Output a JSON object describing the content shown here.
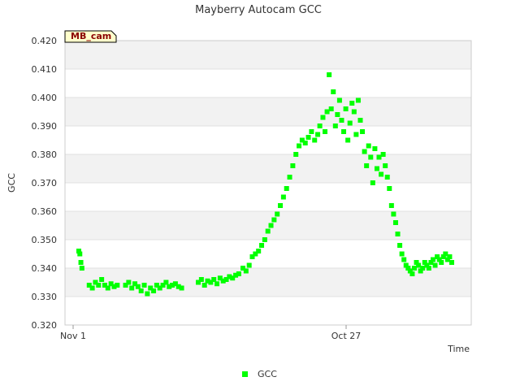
{
  "chart_data": {
    "type": "scatter",
    "title": "Mayberry Autocam GCC",
    "xlabel": "Time",
    "ylabel": "GCC",
    "ylim": [
      0.32,
      0.42
    ],
    "y_ticks": [
      "0.320",
      "0.330",
      "0.340",
      "0.350",
      "0.360",
      "0.370",
      "0.380",
      "0.390",
      "0.400",
      "0.410",
      "0.420"
    ],
    "x_ticks": [
      "Nov 1",
      "Oct 27"
    ],
    "grid": true,
    "legend_position": "bottom",
    "site_tag": "MB_cam",
    "series": [
      {
        "name": "GCC",
        "color": "#00ff00",
        "points": [
          [
            305,
            0.346
          ],
          [
            306,
            0.345
          ],
          [
            307,
            0.342
          ],
          [
            308,
            0.34
          ],
          [
            315,
            0.334
          ],
          [
            318,
            0.333
          ],
          [
            321,
            0.335
          ],
          [
            324,
            0.334
          ],
          [
            327,
            0.336
          ],
          [
            330,
            0.334
          ],
          [
            333,
            0.333
          ],
          [
            336,
            0.3345
          ],
          [
            339,
            0.3335
          ],
          [
            342,
            0.334
          ],
          [
            350,
            0.334
          ],
          [
            353,
            0.335
          ],
          [
            356,
            0.333
          ],
          [
            359,
            0.3345
          ],
          [
            362,
            0.3335
          ],
          [
            365,
            0.332
          ],
          [
            368,
            0.334
          ],
          [
            371,
            0.331
          ],
          [
            374,
            0.333
          ],
          [
            377,
            0.332
          ],
          [
            380,
            0.334
          ],
          [
            383,
            0.333
          ],
          [
            386,
            0.334
          ],
          [
            389,
            0.335
          ],
          [
            392,
            0.3335
          ],
          [
            395,
            0.334
          ],
          [
            398,
            0.3345
          ],
          [
            401,
            0.3335
          ],
          [
            404,
            0.333
          ],
          [
            420,
            0.335
          ],
          [
            423,
            0.336
          ],
          [
            426,
            0.334
          ],
          [
            429,
            0.3355
          ],
          [
            432,
            0.335
          ],
          [
            435,
            0.336
          ],
          [
            438,
            0.3345
          ],
          [
            441,
            0.3365
          ],
          [
            444,
            0.3355
          ],
          [
            447,
            0.336
          ],
          [
            450,
            0.337
          ],
          [
            453,
            0.3365
          ],
          [
            456,
            0.3375
          ],
          [
            459,
            0.338
          ],
          [
            463,
            0.34
          ],
          [
            466,
            0.339
          ],
          [
            469,
            0.341
          ],
          [
            472,
            0.344
          ],
          [
            475,
            0.345
          ],
          [
            478,
            0.346
          ],
          [
            481,
            0.348
          ],
          [
            484,
            0.35
          ],
          [
            487,
            0.353
          ],
          [
            490,
            0.355
          ],
          [
            493,
            0.357
          ],
          [
            496,
            0.359
          ],
          [
            499,
            0.362
          ],
          [
            502,
            0.365
          ],
          [
            505,
            0.368
          ],
          [
            508,
            0.372
          ],
          [
            511,
            0.376
          ],
          [
            514,
            0.38
          ],
          [
            517,
            0.383
          ],
          [
            520,
            0.385
          ],
          [
            523,
            0.384
          ],
          [
            526,
            0.386
          ],
          [
            529,
            0.388
          ],
          [
            532,
            0.385
          ],
          [
            535,
            0.387
          ],
          [
            537,
            0.39
          ],
          [
            540,
            0.393
          ],
          [
            542,
            0.388
          ],
          [
            544,
            0.395
          ],
          [
            546,
            0.408
          ],
          [
            548,
            0.396
          ],
          [
            550,
            0.402
          ],
          [
            552,
            0.39
          ],
          [
            554,
            0.394
          ],
          [
            556,
            0.399
          ],
          [
            558,
            0.392
          ],
          [
            560,
            0.388
          ],
          [
            562,
            0.396
          ],
          [
            564,
            0.385
          ],
          [
            566,
            0.391
          ],
          [
            568,
            0.398
          ],
          [
            570,
            0.395
          ],
          [
            572,
            0.387
          ],
          [
            574,
            0.399
          ],
          [
            576,
            0.392
          ],
          [
            578,
            0.388
          ],
          [
            580,
            0.381
          ],
          [
            582,
            0.376
          ],
          [
            584,
            0.383
          ],
          [
            586,
            0.379
          ],
          [
            588,
            0.37
          ],
          [
            590,
            0.382
          ],
          [
            592,
            0.375
          ],
          [
            594,
            0.379
          ],
          [
            596,
            0.373
          ],
          [
            598,
            0.38
          ],
          [
            600,
            0.376
          ],
          [
            602,
            0.372
          ],
          [
            604,
            0.368
          ],
          [
            606,
            0.362
          ],
          [
            608,
            0.359
          ],
          [
            610,
            0.356
          ],
          [
            612,
            0.352
          ],
          [
            614,
            0.348
          ],
          [
            616,
            0.345
          ],
          [
            618,
            0.343
          ],
          [
            620,
            0.341
          ],
          [
            622,
            0.34
          ],
          [
            624,
            0.339
          ],
          [
            626,
            0.338
          ],
          [
            628,
            0.34
          ],
          [
            630,
            0.342
          ],
          [
            632,
            0.341
          ],
          [
            634,
            0.339
          ],
          [
            636,
            0.34
          ],
          [
            638,
            0.342
          ],
          [
            640,
            0.341
          ],
          [
            642,
            0.34
          ],
          [
            644,
            0.342
          ],
          [
            646,
            0.343
          ],
          [
            648,
            0.341
          ],
          [
            650,
            0.344
          ],
          [
            652,
            0.343
          ],
          [
            654,
            0.342
          ],
          [
            656,
            0.344
          ],
          [
            658,
            0.345
          ],
          [
            660,
            0.343
          ],
          [
            662,
            0.344
          ],
          [
            664,
            0.342
          ]
        ]
      }
    ]
  }
}
